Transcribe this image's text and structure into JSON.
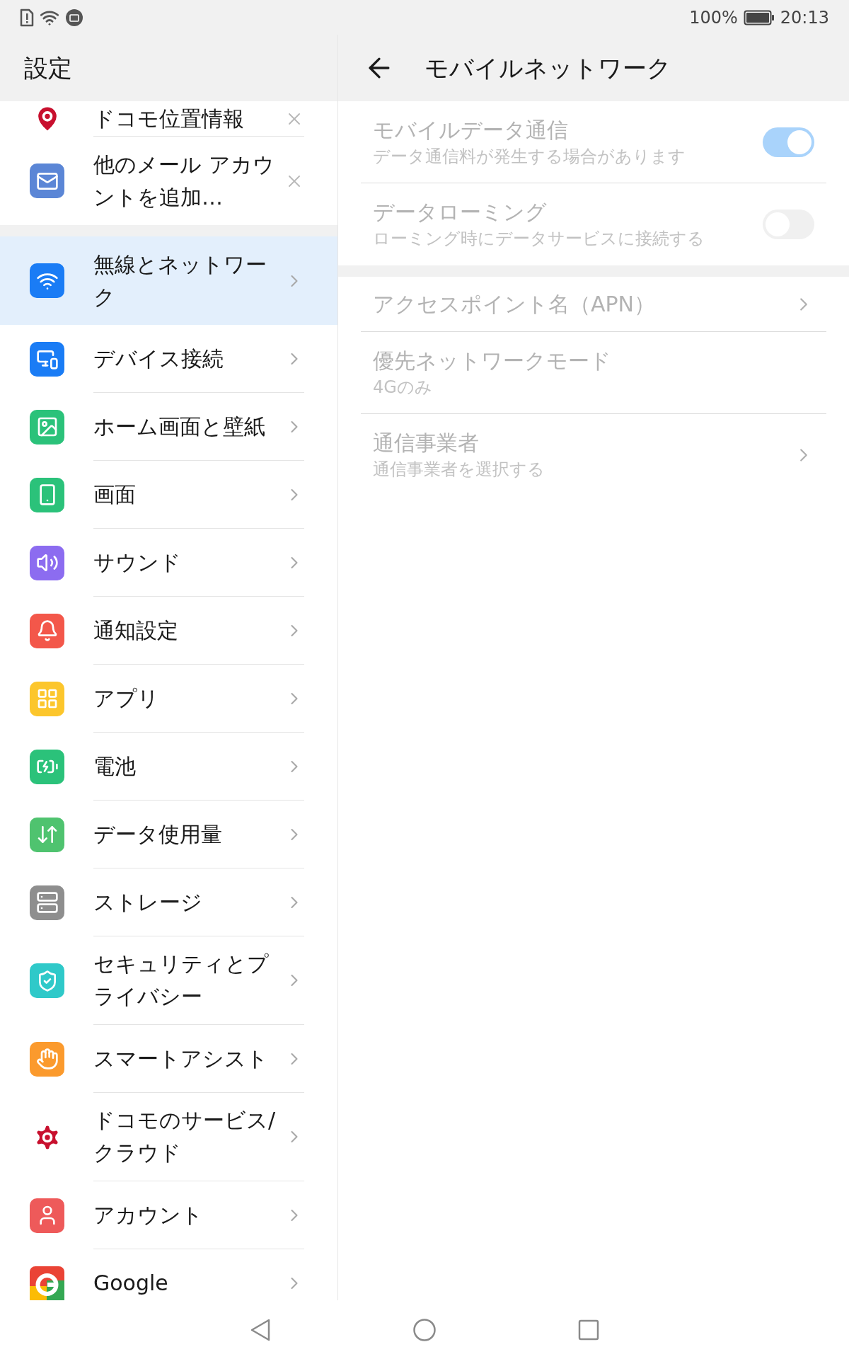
{
  "status_bar": {
    "battery_text": "100%",
    "time": "20:13"
  },
  "sidebar": {
    "title": "設定",
    "groups": [
      {
        "items": [
          {
            "label": "ドコモ位置情報",
            "kind": "closable",
            "selected": false
          },
          {
            "label": "他のメール アカウントを追加…",
            "kind": "closable",
            "selected": false
          }
        ]
      },
      {
        "items": [
          {
            "label": "無線とネットワーク",
            "kind": "link",
            "selected": true
          },
          {
            "label": "デバイス接続",
            "kind": "link",
            "selected": false
          },
          {
            "label": "ホーム画面と壁紙",
            "kind": "link",
            "selected": false
          },
          {
            "label": "画面",
            "kind": "link",
            "selected": false
          },
          {
            "label": "サウンド",
            "kind": "link",
            "selected": false
          },
          {
            "label": "通知設定",
            "kind": "link",
            "selected": false
          },
          {
            "label": "アプリ",
            "kind": "link",
            "selected": false
          },
          {
            "label": "電池",
            "kind": "link",
            "selected": false
          },
          {
            "label": "データ使用量",
            "kind": "link",
            "selected": false
          },
          {
            "label": "ストレージ",
            "kind": "link",
            "selected": false
          },
          {
            "label": "セキュリティとプライバシー",
            "kind": "link",
            "selected": false
          },
          {
            "label": "スマートアシスト",
            "kind": "link",
            "selected": false
          },
          {
            "label": "ドコモのサービス/クラウド",
            "kind": "link",
            "selected": false
          },
          {
            "label": "アカウント",
            "kind": "link",
            "selected": false
          },
          {
            "label": "Google",
            "kind": "link",
            "selected": false
          }
        ]
      }
    ]
  },
  "detail": {
    "title": "モバイルネットワーク",
    "sections": [
      {
        "rows": [
          {
            "kind": "toggle",
            "title": "モバイルデータ通信",
            "summary": "データ通信料が発生する場合があります",
            "on": true,
            "disabled": true
          },
          {
            "kind": "toggle",
            "title": "データローミング",
            "summary": "ローミング時にデータサービスに接続する",
            "on": false,
            "disabled": true
          }
        ]
      },
      {
        "rows": [
          {
            "kind": "link",
            "title": "アクセスポイント名（APN）",
            "disabled": true
          },
          {
            "kind": "info",
            "title": "優先ネットワークモード",
            "summary": "4Gのみ",
            "disabled": true
          },
          {
            "kind": "link",
            "title": "通信事業者",
            "summary": "通信事業者を選択する",
            "disabled": true
          }
        ]
      }
    ]
  }
}
